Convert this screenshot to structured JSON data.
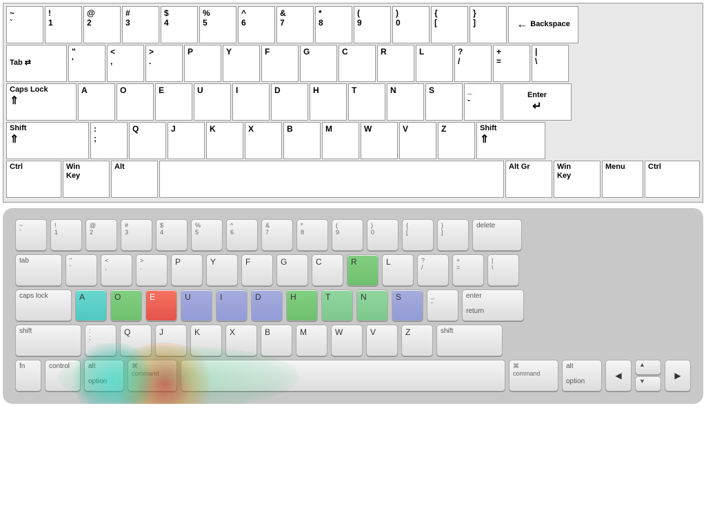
{
  "topKeyboard": {
    "rows": [
      {
        "keys": [
          {
            "id": "tilde",
            "top": "~",
            "bot": "`",
            "width": "normal"
          },
          {
            "id": "1",
            "top": "!",
            "bot": "1",
            "width": "normal"
          },
          {
            "id": "2",
            "top": "@",
            "bot": "2",
            "width": "normal"
          },
          {
            "id": "3",
            "top": "#",
            "bot": "3",
            "width": "normal"
          },
          {
            "id": "4",
            "top": "$",
            "bot": "4",
            "width": "normal"
          },
          {
            "id": "5",
            "top": "%",
            "bot": "5",
            "width": "normal"
          },
          {
            "id": "6",
            "top": "^",
            "bot": "6",
            "width": "normal"
          },
          {
            "id": "7",
            "top": "&",
            "bot": "7",
            "width": "normal"
          },
          {
            "id": "8",
            "top": "*",
            "bot": "8",
            "width": "normal"
          },
          {
            "id": "9",
            "top": "(",
            "bot": "9",
            "width": "normal"
          },
          {
            "id": "0",
            "top": ")",
            "bot": "0",
            "width": "normal"
          },
          {
            "id": "lbracket",
            "top": "{",
            "bot": "[",
            "width": "normal"
          },
          {
            "id": "rbracket",
            "top": "}",
            "bot": "]",
            "width": "normal"
          },
          {
            "id": "backspace",
            "label": "Backspace",
            "icon": "←",
            "width": "wide"
          }
        ]
      },
      {
        "keys": [
          {
            "id": "tab",
            "label": "Tab",
            "icon": "⇥",
            "width": "tab"
          },
          {
            "id": "quote",
            "top": "\"",
            "bot": "'",
            "width": "normal"
          },
          {
            "id": "comma",
            "top": "<",
            "bot": ",",
            "width": "normal"
          },
          {
            "id": "period",
            "top": ">",
            "bot": ".",
            "width": "normal"
          },
          {
            "id": "p",
            "top": "P",
            "width": "normal"
          },
          {
            "id": "y",
            "top": "Y",
            "width": "normal"
          },
          {
            "id": "f",
            "top": "F",
            "width": "normal"
          },
          {
            "id": "g",
            "top": "G",
            "width": "normal"
          },
          {
            "id": "c",
            "top": "C",
            "width": "normal"
          },
          {
            "id": "r",
            "top": "R",
            "width": "normal"
          },
          {
            "id": "l",
            "top": "L",
            "width": "normal"
          },
          {
            "id": "slash",
            "top": "?",
            "bot": "/",
            "width": "normal"
          },
          {
            "id": "equals",
            "top": "+",
            "bot": "=",
            "width": "normal"
          },
          {
            "id": "backslash",
            "top": "",
            "bot": "\\",
            "width": "normal"
          }
        ]
      },
      {
        "keys": [
          {
            "id": "capslock",
            "label": "Caps Lock",
            "icon": "⇑",
            "width": "caps"
          },
          {
            "id": "a",
            "top": "A",
            "width": "normal"
          },
          {
            "id": "o",
            "top": "O",
            "width": "normal"
          },
          {
            "id": "e",
            "top": "E",
            "width": "normal"
          },
          {
            "id": "u",
            "top": "U",
            "width": "normal"
          },
          {
            "id": "i",
            "top": "I",
            "width": "normal"
          },
          {
            "id": "d",
            "top": "D",
            "width": "normal"
          },
          {
            "id": "h",
            "top": "H",
            "width": "normal"
          },
          {
            "id": "t",
            "top": "T",
            "width": "normal"
          },
          {
            "id": "n",
            "top": "N",
            "width": "normal"
          },
          {
            "id": "s",
            "top": "S",
            "width": "normal"
          },
          {
            "id": "dash",
            "top": "_",
            "bot": "-",
            "width": "normal"
          },
          {
            "id": "enter",
            "label": "Enter",
            "icon": "↵",
            "width": "enter"
          }
        ]
      },
      {
        "keys": [
          {
            "id": "shift-l",
            "label": "Shift",
            "icon": "⇑",
            "width": "shift-l"
          },
          {
            "id": "semicolon",
            "top": ":",
            "bot": ";",
            "width": "normal"
          },
          {
            "id": "q",
            "top": "Q",
            "width": "normal"
          },
          {
            "id": "j",
            "top": "J",
            "width": "normal"
          },
          {
            "id": "k",
            "top": "K",
            "width": "normal"
          },
          {
            "id": "x",
            "top": "X",
            "width": "normal"
          },
          {
            "id": "b",
            "top": "B",
            "width": "normal"
          },
          {
            "id": "m",
            "top": "M",
            "width": "normal"
          },
          {
            "id": "w",
            "top": "W",
            "width": "normal"
          },
          {
            "id": "v",
            "top": "V",
            "width": "normal"
          },
          {
            "id": "z",
            "top": "Z",
            "width": "normal"
          },
          {
            "id": "shift-r",
            "label": "Shift",
            "icon": "⇑",
            "width": "shift-r"
          }
        ]
      },
      {
        "keys": [
          {
            "id": "ctrl-l",
            "label": "Ctrl",
            "width": "ctrl"
          },
          {
            "id": "win-l",
            "label": "Win\nKey",
            "width": "win"
          },
          {
            "id": "alt-l",
            "label": "Alt",
            "width": "alt"
          },
          {
            "id": "space",
            "label": "",
            "width": "space"
          },
          {
            "id": "altgr",
            "label": "Alt Gr",
            "width": "altgr"
          },
          {
            "id": "win-r",
            "label": "Win\nKey",
            "width": "win"
          },
          {
            "id": "menu",
            "label": "Menu",
            "width": "menu"
          },
          {
            "id": "ctrl-r",
            "label": "Ctrl",
            "width": "ctrl"
          }
        ]
      }
    ]
  },
  "bottomKeyboard": {
    "heatKeys": {
      "E": "red",
      "A": "cyan",
      "O": "green",
      "I": "blue",
      "D": "blue",
      "H": "green",
      "T": "green2",
      "N": "green2",
      "S": "blue",
      "U": "blue",
      "R": "green"
    }
  }
}
